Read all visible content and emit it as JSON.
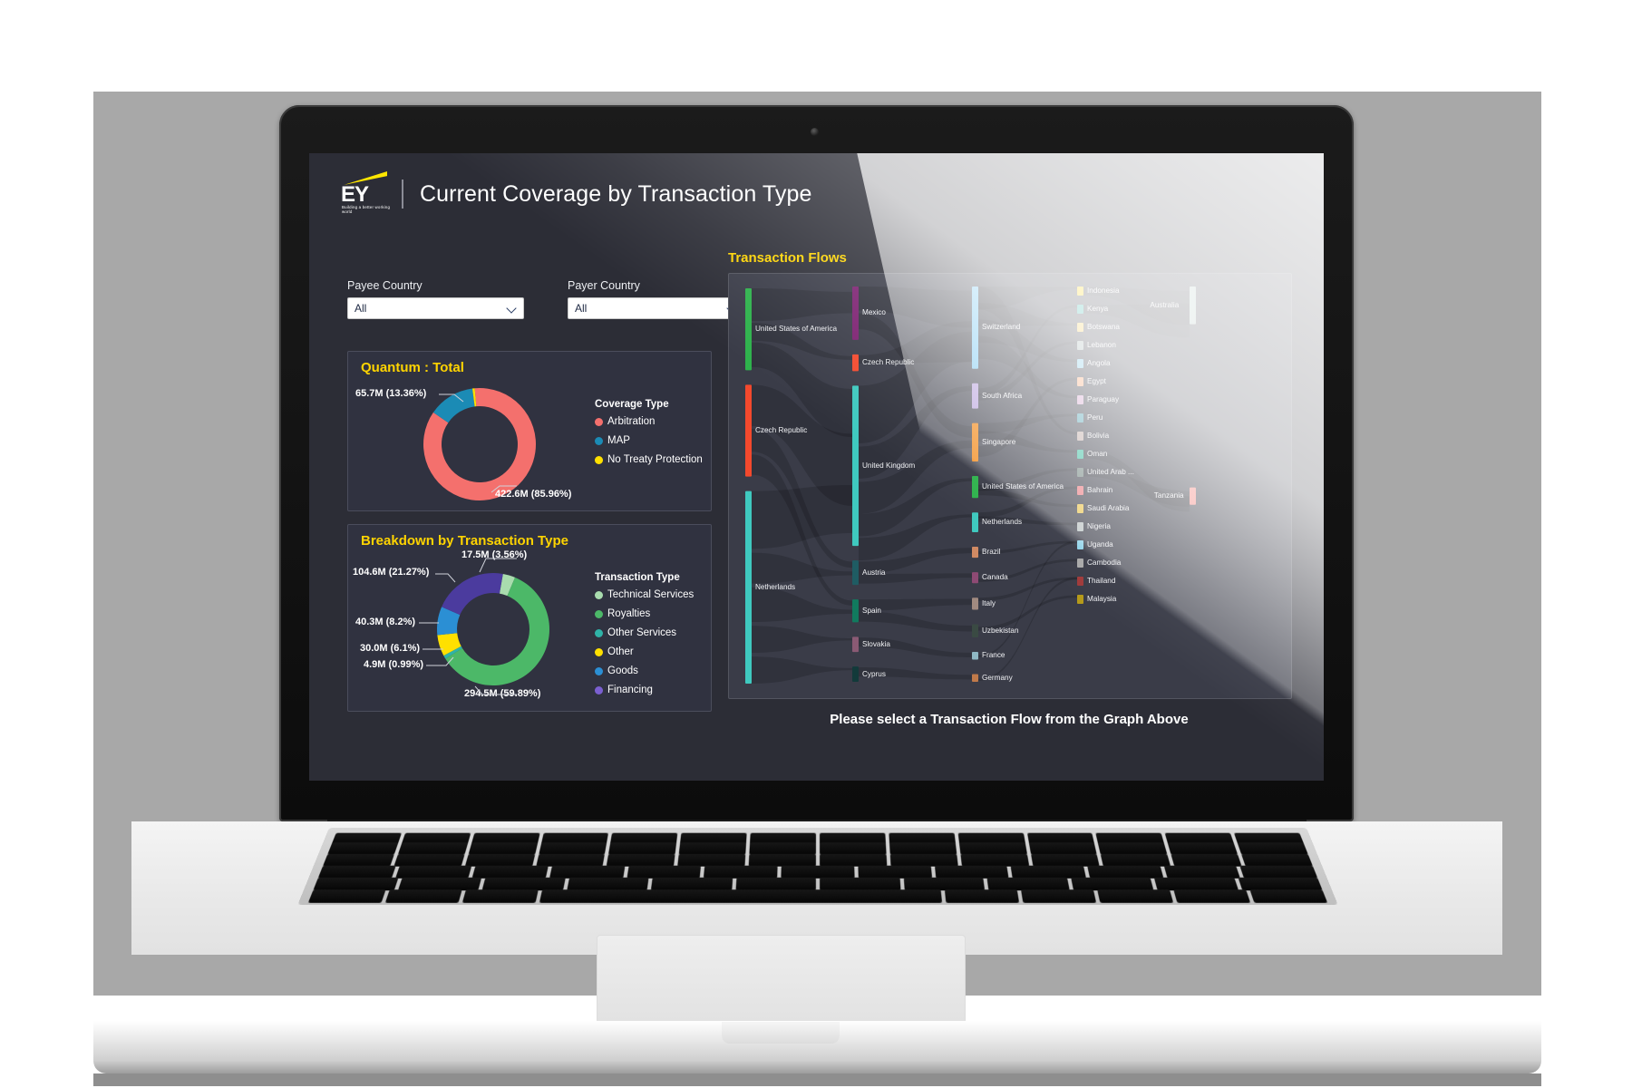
{
  "header": {
    "brand": "EY",
    "brand_tagline": "Building a better working world",
    "title": "Current Coverage by Transaction Type"
  },
  "filters": [
    {
      "label": "Payee Country",
      "value": "All",
      "icon": "chevron-down-icon"
    },
    {
      "label": "Payer Country",
      "value": "All",
      "icon": "chevron-down-icon"
    }
  ],
  "cards": {
    "quantum": {
      "title": "Quantum : Total"
    },
    "breakdown": {
      "title": "Breakdown by Transaction Type"
    },
    "flows": {
      "title": "Transaction Flows",
      "prompt": "Please select a Transaction Flow from the Graph Above"
    }
  },
  "chart_data": [
    {
      "type": "pie",
      "title": "Quantum : Total",
      "legend_title": "Coverage Type",
      "legend_position": "right",
      "labels": [
        "Arbitration",
        "MAP",
        "No Treaty Protection"
      ],
      "values": [
        422.6,
        65.7,
        3.3
      ],
      "units": "M",
      "percents": [
        85.96,
        13.36,
        0.68
      ],
      "colors": [
        "#f4706d",
        "#1b8bb5",
        "#ffe000"
      ],
      "data_labels": [
        "422.6M (85.96%)",
        "65.7M (13.36%)"
      ]
    },
    {
      "type": "pie",
      "title": "Breakdown by Transaction Type",
      "legend_title": "Transaction Type",
      "legend_position": "right",
      "labels": [
        "Technical Services",
        "Royalties",
        "Other Services",
        "Other",
        "Goods",
        "Financing"
      ],
      "values": [
        17.5,
        294.5,
        4.9,
        30.0,
        40.3,
        104.6
      ],
      "units": "M",
      "percents": [
        3.56,
        59.89,
        0.99,
        6.1,
        8.2,
        21.27
      ],
      "colors": [
        "#a9dcae",
        "#4cb868",
        "#2fb3a8",
        "#ffe000",
        "#2b8fd4",
        "#4b3b9e"
      ],
      "data_labels": [
        "17.5M (3.56%)",
        "294.5M (59.89%)",
        "4.9M (0.99%)",
        "30.0M (6.1%)",
        "40.3M (8.2%)",
        "104.6M (21.27%)"
      ]
    },
    {
      "type": "sankey",
      "title": "Transaction Flows",
      "columns": [
        {
          "name": "column-1",
          "nodes": [
            {
              "label": "United States of America",
              "color": "#2eb24c",
              "value": 100
            },
            {
              "label": "Czech Republic",
              "color": "#f4492d",
              "value": 112
            },
            {
              "label": "Netherlands",
              "color": "#3fc9bf",
              "value": 235
            }
          ]
        },
        {
          "name": "column-2",
          "nodes": [
            {
              "label": "Mexico",
              "color": "#7b1f70",
              "value": 70
            },
            {
              "label": "Czech Republic",
              "color": "#f4492d",
              "value": 22
            },
            {
              "label": "United Kingdom",
              "color": "#3fc9bf",
              "value": 210
            },
            {
              "label": "Austria",
              "color": "#1f5c63",
              "value": 32
            },
            {
              "label": "Spain",
              "color": "#117a5e",
              "value": 30
            },
            {
              "label": "Slovakia",
              "color": "#8a5a74",
              "value": 20
            },
            {
              "label": "Cyprus",
              "color": "#123a3a",
              "value": 20
            }
          ]
        },
        {
          "name": "column-3",
          "nodes": [
            {
              "label": "Switzerland",
              "color": "#6fc3f0",
              "value": 150
            },
            {
              "label": "South Africa",
              "color": "#b097d8",
              "value": 46
            },
            {
              "label": "Singapore",
              "color": "#f07c00",
              "value": 70
            },
            {
              "label": "United States of America",
              "color": "#2eb24c",
              "value": 40
            },
            {
              "label": "Netherlands",
              "color": "#3fc9bf",
              "value": 36
            },
            {
              "label": "Brazil",
              "color": "#d08a63",
              "value": 20
            },
            {
              "label": "Canada",
              "color": "#8e4a74",
              "value": 20
            },
            {
              "label": "Italy",
              "color": "#a18a80",
              "value": 22
            },
            {
              "label": "Uzbekistan",
              "color": "#3a4a43",
              "value": 24
            },
            {
              "label": "France",
              "color": "#8fb8c4",
              "value": 14
            },
            {
              "label": "Germany",
              "color": "#c07a4a",
              "value": 14
            }
          ]
        },
        {
          "name": "column-4",
          "nodes": [
            {
              "label": "Indonesia",
              "color": "#ffd400",
              "value": 16
            },
            {
              "label": "Kenya",
              "color": "#2fb3a8",
              "value": 16
            },
            {
              "label": "Botswana",
              "color": "#f2c94c",
              "value": 16
            },
            {
              "label": "Lebanon",
              "color": "#9fb0b0",
              "value": 16
            },
            {
              "label": "Angola",
              "color": "#7fc8e8",
              "value": 16
            },
            {
              "label": "Egypt",
              "color": "#f5a878",
              "value": 16
            },
            {
              "label": "Paraguay",
              "color": "#d2a4cd",
              "value": 16
            },
            {
              "label": "Peru",
              "color": "#4f9fb0",
              "value": 16
            },
            {
              "label": "Bolivia",
              "color": "#bba7a2",
              "value": 16
            },
            {
              "label": "Oman",
              "color": "#2fb89a",
              "value": 16
            },
            {
              "label": "United Arab ...",
              "color": "#6b7f7a",
              "value": 16
            },
            {
              "label": "Bahrain",
              "color": "#e8757c",
              "value": 16
            },
            {
              "label": "Saudi Arabia",
              "color": "#e8c24a",
              "value": 16
            },
            {
              "label": "Nigeria",
              "color": "#b8c0c0",
              "value": 16
            },
            {
              "label": "Uganda",
              "color": "#8fd2e8",
              "value": 16
            },
            {
              "label": "Cambodia",
              "color": "#a8a8a8",
              "value": 16
            },
            {
              "label": "Thailand",
              "color": "#a03a3a",
              "value": 16
            },
            {
              "label": "Malaysia",
              "color": "#b59a1a",
              "value": 16
            }
          ]
        },
        {
          "name": "column-5",
          "nodes": [
            {
              "label": "Australia",
              "color": "#a9c4bd",
              "value": 26
            },
            {
              "label": "Tanzania",
              "color": "#f4857f",
              "value": 12
            }
          ]
        }
      ]
    }
  ],
  "colors": {
    "accent_yellow": "#ffd400",
    "panel_bg": "#303240",
    "screen_bg": "#2c2d36",
    "sankey_bg": "#3a3c48"
  }
}
